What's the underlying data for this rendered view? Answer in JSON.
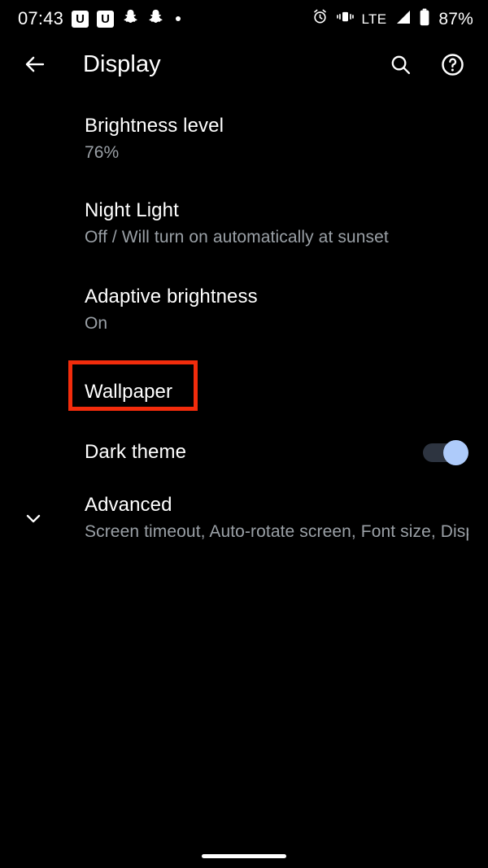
{
  "status_bar": {
    "time": "07:43",
    "left_icons": [
      {
        "name": "u-app-badge-icon",
        "glyph": "U"
      },
      {
        "name": "u-app-badge-icon",
        "glyph": "U"
      },
      {
        "name": "snapchat-icon",
        "glyph": "ghost"
      },
      {
        "name": "snapchat-icon",
        "glyph": "ghost"
      },
      {
        "name": "more-notifications-dot-icon",
        "glyph": "dot"
      }
    ],
    "right": {
      "alarm_icon": "alarm-icon",
      "vibrate_icon": "vibrate-icon",
      "network_type": "LTE",
      "signal_icon": "signal-bars-icon",
      "battery_icon": "battery-icon",
      "battery_percent": "87%"
    }
  },
  "app_bar": {
    "back_label": "Back",
    "title": "Display",
    "search_label": "Search",
    "help_label": "Help"
  },
  "settings": {
    "items": [
      {
        "title": "Brightness level",
        "summary": "76%"
      },
      {
        "title": "Night Light",
        "summary": "Off / Will turn on automatically at sunset"
      },
      {
        "title": "Adaptive brightness",
        "summary": "On"
      },
      {
        "title": "Wallpaper",
        "summary": ""
      },
      {
        "title": "Dark theme",
        "summary": ""
      },
      {
        "title": "Advanced",
        "summary": "Screen timeout, Auto-rotate screen, Font size, Displ.."
      }
    ]
  },
  "dark_theme_toggle": {
    "state": "on",
    "track_color": "#2d3440",
    "thumb_color": "#aecbfa"
  },
  "annotation": {
    "target": "Wallpaper",
    "color": "#f22c0c"
  },
  "navigation": {
    "gesture_pill_label": "Home gesture bar"
  }
}
